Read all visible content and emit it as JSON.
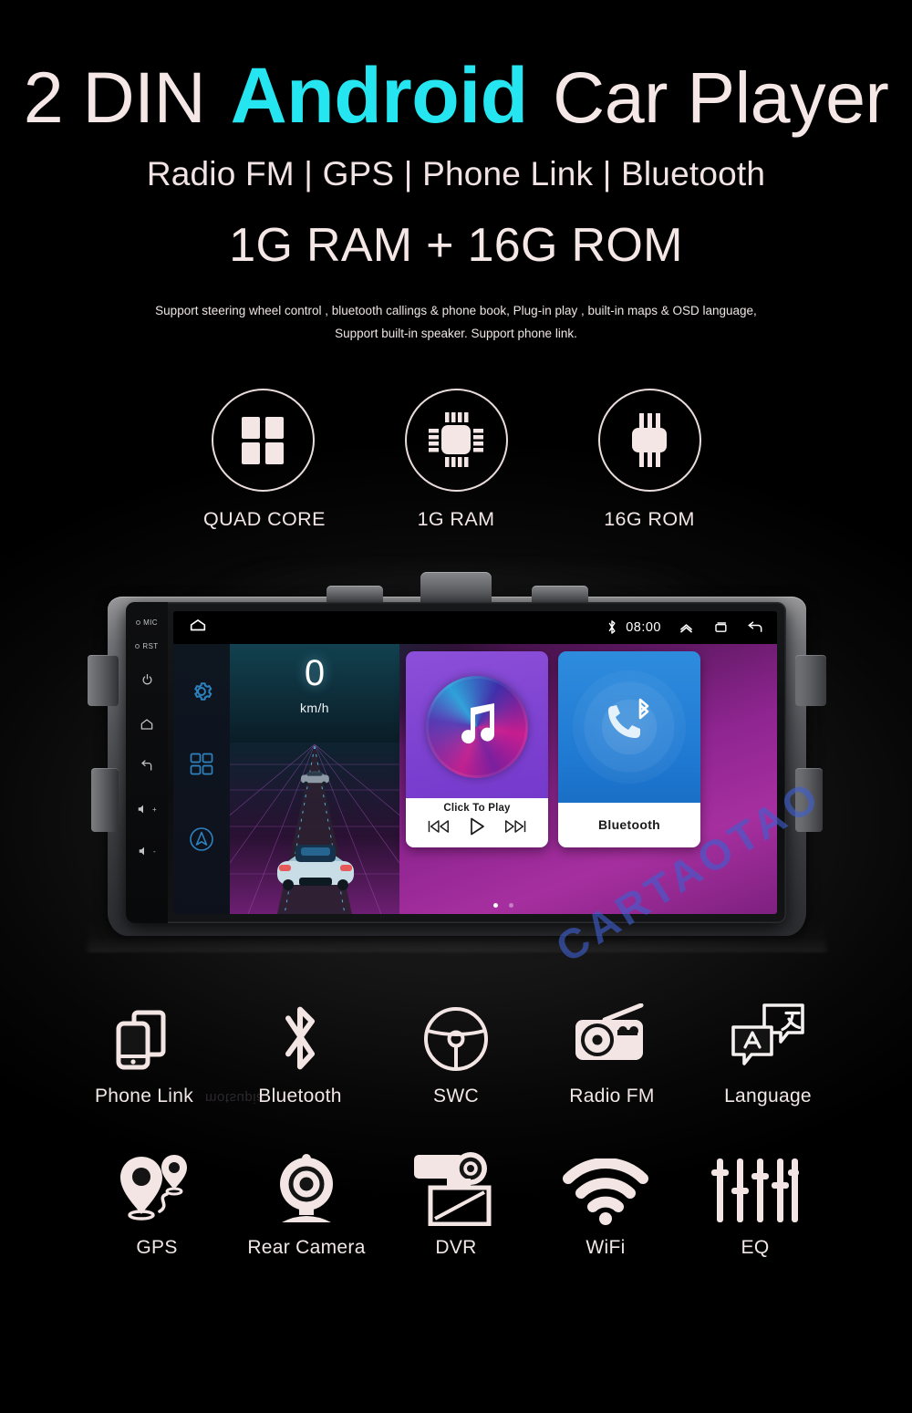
{
  "hero": {
    "title_pre": "2 DIN",
    "title_accent": "Android",
    "title_post": "Car Player",
    "subtitle": "Radio FM | GPS | Phone Link | Bluetooth",
    "spec": "1G RAM + 16G ROM",
    "description_line1": "Support steering wheel control , bluetooth callings & phone book,  Plug-in play , built-in maps & OSD language,",
    "description_line2": "Support built-in speaker. Support phone link.",
    "accent_color": "#25e6f0",
    "text_color": "#f4e7e6"
  },
  "spec_circles": [
    {
      "label": "QUAD CORE",
      "icon": "quad-core-icon"
    },
    {
      "label": "1G RAM",
      "icon": "ram-chip-icon"
    },
    {
      "label": "16G ROM",
      "icon": "rom-chip-icon"
    }
  ],
  "device": {
    "side_buttons": [
      {
        "label": "MIC",
        "icon": "mic-led-icon"
      },
      {
        "label": "RST",
        "icon": "reset-led-icon"
      },
      {
        "label": "",
        "icon": "power-icon"
      },
      {
        "label": "",
        "icon": "home-icon"
      },
      {
        "label": "",
        "icon": "back-icon"
      },
      {
        "label": "+",
        "icon": "volume-up-icon"
      },
      {
        "label": "-",
        "icon": "volume-down-icon"
      }
    ],
    "statusbar": {
      "home_icon": "home-icon",
      "bluetooth_icon": "bluetooth-icon",
      "clock": "08:00",
      "expand_icon": "chevron-up-icon",
      "recents_icon": "recents-icon",
      "back_icon": "back-arrow-icon"
    },
    "nav_rail": [
      {
        "icon": "gear-icon"
      },
      {
        "icon": "apps-grid-icon"
      },
      {
        "icon": "navigation-arrow-icon"
      }
    ],
    "speedometer": {
      "value": "0",
      "unit": "km/h"
    },
    "widgets": [
      {
        "name": "music",
        "icon": "music-note-icon",
        "title": "Click To Play",
        "controls": [
          {
            "label": "prev",
            "icon": "previous-track-icon"
          },
          {
            "label": "play",
            "icon": "play-icon"
          },
          {
            "label": "next",
            "icon": "next-track-icon"
          }
        ]
      },
      {
        "name": "bluetooth",
        "icon": "bluetooth-phone-icon",
        "title": "Bluetooth"
      }
    ],
    "page_dots": {
      "count": 2,
      "active": 1
    }
  },
  "features": {
    "row1": [
      {
        "label": "Phone Link",
        "icon": "phone-link-icon"
      },
      {
        "label": "Bluetooth",
        "icon": "bluetooth-icon"
      },
      {
        "label": "SWC",
        "icon": "steering-wheel-icon"
      },
      {
        "label": "Radio  FM",
        "icon": "radio-icon"
      },
      {
        "label": "Language",
        "icon": "language-icon"
      }
    ],
    "row2": [
      {
        "label": "GPS",
        "icon": "gps-pin-icon"
      },
      {
        "label": "Rear Camera",
        "icon": "rear-camera-icon"
      },
      {
        "label": "DVR",
        "icon": "dvr-icon"
      },
      {
        "label": "WiFi",
        "icon": "wifi-icon"
      },
      {
        "label": "EQ",
        "icon": "equalizer-icon"
      }
    ]
  },
  "watermark": {
    "text": "CARTAOTAO",
    "color": "#3f5fd0",
    "mirror_text": "motsupia"
  }
}
